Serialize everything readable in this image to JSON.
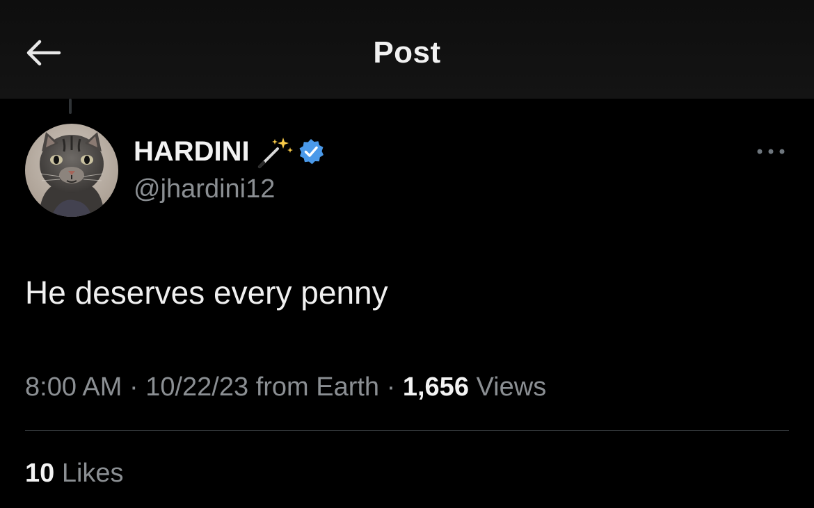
{
  "header": {
    "title": "Post",
    "back_icon": "arrow-left-icon"
  },
  "post": {
    "author": {
      "display_name": "HARDINI",
      "name_emoji": "magic-wand-sparkles-icon",
      "verified_icon": "verified-badge-icon",
      "verified_color": "#4a99e9",
      "handle": "@jhardini12",
      "avatar": "cat-avatar"
    },
    "more_icon": "more-horizontal-icon",
    "text": "He deserves every penny",
    "meta": {
      "time": "8:00 AM",
      "separator": "·",
      "date": "10/22/23",
      "source": "from Earth",
      "views_count": "1,656",
      "views_label": "Views"
    },
    "likes": {
      "count": "10",
      "label": "Likes"
    }
  },
  "colors": {
    "background": "#000000",
    "header_background": "#111111",
    "primary_text": "#e7e9ea",
    "secondary_text": "#8b8f93",
    "divider": "#2f3336"
  }
}
